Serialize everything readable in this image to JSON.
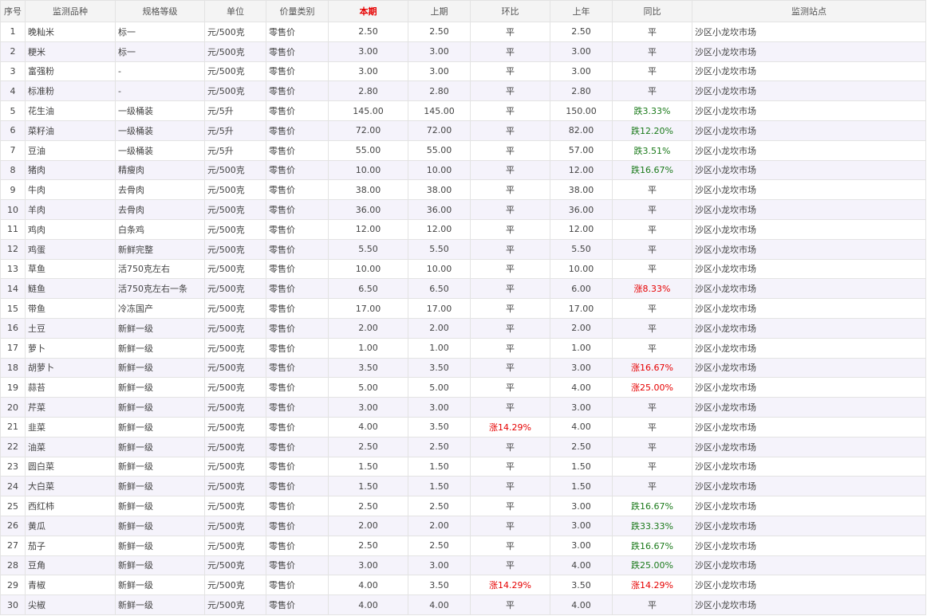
{
  "headers": [
    "序号",
    "监测品种",
    "规格等级",
    "单位",
    "价量类别",
    "本期",
    "上期",
    "环比",
    "上年",
    "同比",
    "监测站点"
  ],
  "rows": [
    [
      "1",
      "晚籼米",
      "标一",
      "元/500克",
      "零售价",
      "2.50",
      "2.50",
      "平",
      "2.50",
      "平",
      "沙区小龙坎市场"
    ],
    [
      "2",
      "粳米",
      "标一",
      "元/500克",
      "零售价",
      "3.00",
      "3.00",
      "平",
      "3.00",
      "平",
      "沙区小龙坎市场"
    ],
    [
      "3",
      "富强粉",
      "-",
      "元/500克",
      "零售价",
      "3.00",
      "3.00",
      "平",
      "3.00",
      "平",
      "沙区小龙坎市场"
    ],
    [
      "4",
      "标准粉",
      "-",
      "元/500克",
      "零售价",
      "2.80",
      "2.80",
      "平",
      "2.80",
      "平",
      "沙区小龙坎市场"
    ],
    [
      "5",
      "花生油",
      "一级桶装",
      "元/5升",
      "零售价",
      "145.00",
      "145.00",
      "平",
      "150.00",
      "跌3.33%",
      "沙区小龙坎市场"
    ],
    [
      "6",
      "菜籽油",
      "一级桶装",
      "元/5升",
      "零售价",
      "72.00",
      "72.00",
      "平",
      "82.00",
      "跌12.20%",
      "沙区小龙坎市场"
    ],
    [
      "7",
      "豆油",
      "一级桶装",
      "元/5升",
      "零售价",
      "55.00",
      "55.00",
      "平",
      "57.00",
      "跌3.51%",
      "沙区小龙坎市场"
    ],
    [
      "8",
      "猪肉",
      "精瘦肉",
      "元/500克",
      "零售价",
      "10.00",
      "10.00",
      "平",
      "12.00",
      "跌16.67%",
      "沙区小龙坎市场"
    ],
    [
      "9",
      "牛肉",
      "去骨肉",
      "元/500克",
      "零售价",
      "38.00",
      "38.00",
      "平",
      "38.00",
      "平",
      "沙区小龙坎市场"
    ],
    [
      "10",
      "羊肉",
      "去骨肉",
      "元/500克",
      "零售价",
      "36.00",
      "36.00",
      "平",
      "36.00",
      "平",
      "沙区小龙坎市场"
    ],
    [
      "11",
      "鸡肉",
      "白条鸡",
      "元/500克",
      "零售价",
      "12.00",
      "12.00",
      "平",
      "12.00",
      "平",
      "沙区小龙坎市场"
    ],
    [
      "12",
      "鸡蛋",
      "新鲜完整",
      "元/500克",
      "零售价",
      "5.50",
      "5.50",
      "平",
      "5.50",
      "平",
      "沙区小龙坎市场"
    ],
    [
      "13",
      "草鱼",
      "活750克左右",
      "元/500克",
      "零售价",
      "10.00",
      "10.00",
      "平",
      "10.00",
      "平",
      "沙区小龙坎市场"
    ],
    [
      "14",
      "鲢鱼",
      "活750克左右一条",
      "元/500克",
      "零售价",
      "6.50",
      "6.50",
      "平",
      "6.00",
      "涨8.33%",
      "沙区小龙坎市场"
    ],
    [
      "15",
      "带鱼",
      "冷冻国产",
      "元/500克",
      "零售价",
      "17.00",
      "17.00",
      "平",
      "17.00",
      "平",
      "沙区小龙坎市场"
    ],
    [
      "16",
      "土豆",
      "新鲜一级",
      "元/500克",
      "零售价",
      "2.00",
      "2.00",
      "平",
      "2.00",
      "平",
      "沙区小龙坎市场"
    ],
    [
      "17",
      "萝卜",
      "新鲜一级",
      "元/500克",
      "零售价",
      "1.00",
      "1.00",
      "平",
      "1.00",
      "平",
      "沙区小龙坎市场"
    ],
    [
      "18",
      "胡萝卜",
      "新鲜一级",
      "元/500克",
      "零售价",
      "3.50",
      "3.50",
      "平",
      "3.00",
      "涨16.67%",
      "沙区小龙坎市场"
    ],
    [
      "19",
      "蒜苔",
      "新鲜一级",
      "元/500克",
      "零售价",
      "5.00",
      "5.00",
      "平",
      "4.00",
      "涨25.00%",
      "沙区小龙坎市场"
    ],
    [
      "20",
      "芹菜",
      "新鲜一级",
      "元/500克",
      "零售价",
      "3.00",
      "3.00",
      "平",
      "3.00",
      "平",
      "沙区小龙坎市场"
    ],
    [
      "21",
      "韭菜",
      "新鲜一级",
      "元/500克",
      "零售价",
      "4.00",
      "3.50",
      "涨14.29%",
      "4.00",
      "平",
      "沙区小龙坎市场"
    ],
    [
      "22",
      "油菜",
      "新鲜一级",
      "元/500克",
      "零售价",
      "2.50",
      "2.50",
      "平",
      "2.50",
      "平",
      "沙区小龙坎市场"
    ],
    [
      "23",
      "圆白菜",
      "新鲜一级",
      "元/500克",
      "零售价",
      "1.50",
      "1.50",
      "平",
      "1.50",
      "平",
      "沙区小龙坎市场"
    ],
    [
      "24",
      "大白菜",
      "新鲜一级",
      "元/500克",
      "零售价",
      "1.50",
      "1.50",
      "平",
      "1.50",
      "平",
      "沙区小龙坎市场"
    ],
    [
      "25",
      "西红柿",
      "新鲜一级",
      "元/500克",
      "零售价",
      "2.50",
      "2.50",
      "平",
      "3.00",
      "跌16.67%",
      "沙区小龙坎市场"
    ],
    [
      "26",
      "黄瓜",
      "新鲜一级",
      "元/500克",
      "零售价",
      "2.00",
      "2.00",
      "平",
      "3.00",
      "跌33.33%",
      "沙区小龙坎市场"
    ],
    [
      "27",
      "茄子",
      "新鲜一级",
      "元/500克",
      "零售价",
      "2.50",
      "2.50",
      "平",
      "3.00",
      "跌16.67%",
      "沙区小龙坎市场"
    ],
    [
      "28",
      "豆角",
      "新鲜一级",
      "元/500克",
      "零售价",
      "3.00",
      "3.00",
      "平",
      "4.00",
      "跌25.00%",
      "沙区小龙坎市场"
    ],
    [
      "29",
      "青椒",
      "新鲜一级",
      "元/500克",
      "零售价",
      "4.00",
      "3.50",
      "涨14.29%",
      "3.50",
      "涨14.29%",
      "沙区小龙坎市场"
    ],
    [
      "30",
      "尖椒",
      "新鲜一级",
      "元/500克",
      "零售价",
      "4.00",
      "4.00",
      "平",
      "4.00",
      "平",
      "沙区小龙坎市场"
    ]
  ],
  "colors": {
    "up": "#e60000",
    "down": "#1a7a1a",
    "highlight_header": "#e60000"
  }
}
